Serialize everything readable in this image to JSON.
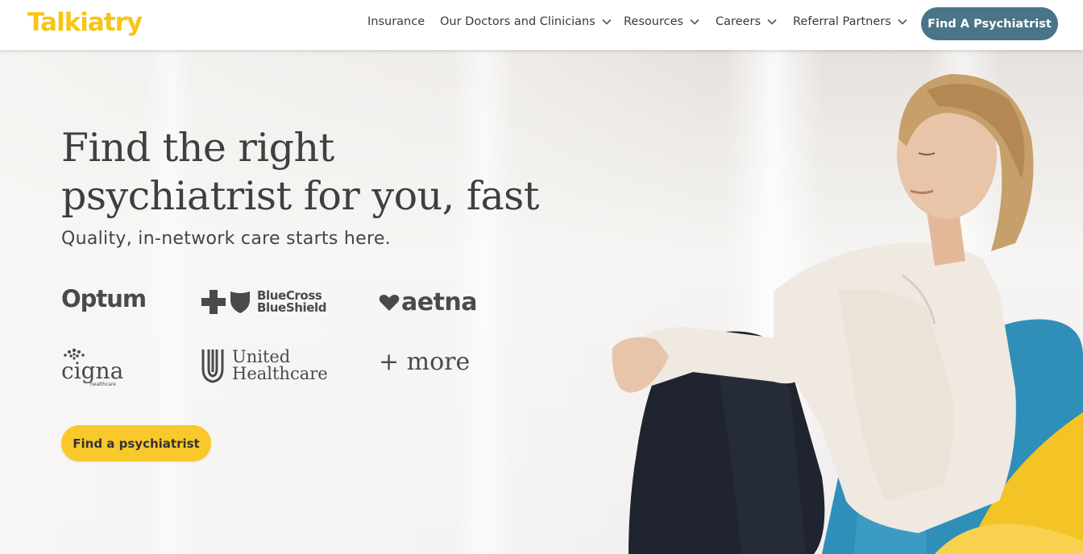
{
  "header": {
    "logo": "Talkiatry",
    "nav": [
      {
        "label": "Insurance",
        "dropdown": false
      },
      {
        "label": "Our Doctors and Clinicians",
        "dropdown": true
      },
      {
        "label": "Resources",
        "dropdown": true
      },
      {
        "label": "Careers",
        "dropdown": true
      },
      {
        "label": "Referral Partners",
        "dropdown": true
      }
    ],
    "cta": "Find A Psychiatrist"
  },
  "hero": {
    "title_line1": "Find the right",
    "title_line2": "psychiatrist for you, fast",
    "subtitle": "Quality, in-network care starts here.",
    "insurers": {
      "optum": "Optum",
      "bcbs_line1": "BlueCross",
      "bcbs_line2": "BlueShield",
      "aetna": "aetna",
      "cigna": "cigna",
      "cigna_sub": "healthcare",
      "uhc_line1": "United",
      "uhc_line2": "Healthcare",
      "more": "+ more"
    },
    "cta": "Find a psychiatrist"
  },
  "colors": {
    "brand_yellow": "#f8c514",
    "button_teal": "#4a7487",
    "cta_yellow": "#f9c82a",
    "text_dark": "#3f3f3f"
  },
  "icons": {
    "chevron": "chevron-down-icon",
    "bcbs_cross": "bluecross-cross-icon",
    "bcbs_shield": "blueshield-shield-icon",
    "aetna_heart": "heart-icon",
    "cigna_tree": "cigna-tree-icon",
    "uhc_mark": "united-healthcare-u-icon"
  }
}
